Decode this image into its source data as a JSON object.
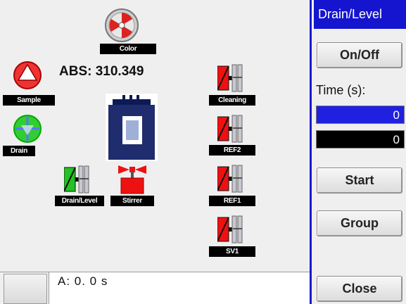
{
  "sidebar": {
    "title": "Drain/Level",
    "on_off_label": "On/Off",
    "time_label": "Time (s):",
    "time_value": "0",
    "time_value_2": "0",
    "start_label": "Start",
    "group_label": "Group",
    "close_label": "Close"
  },
  "canvas": {
    "abs_label": "ABS: 310.349",
    "components": {
      "color": "Color",
      "sample": "Sample",
      "drain": "Drain",
      "drain_level": "Drain/Level",
      "stirrer": "Stirrer",
      "cleaning": "Cleaning",
      "ref2": "REF2",
      "ref1": "REF1",
      "sv1": "SV1"
    }
  },
  "status": {
    "text": "A:  0.  0 s"
  }
}
